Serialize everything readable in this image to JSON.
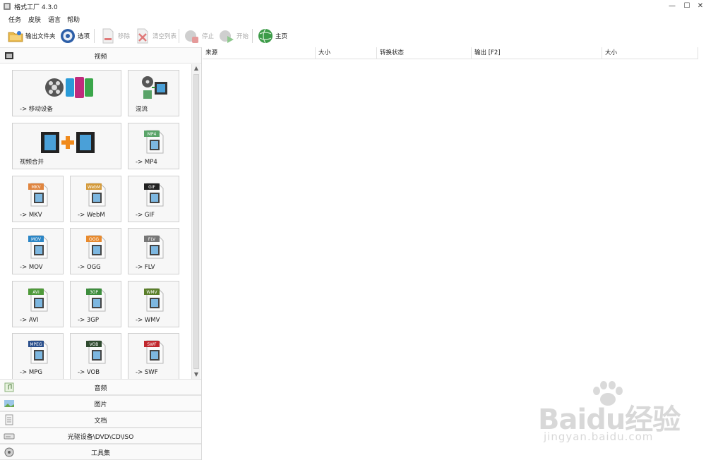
{
  "window": {
    "title": "格式工厂 4.3.0",
    "controls": [
      "—",
      "☐",
      "✕"
    ]
  },
  "menu": [
    "任务",
    "皮肤",
    "语言",
    "帮助"
  ],
  "toolbar": {
    "output_folder": "输出文件夹",
    "options": "选项",
    "remove": "移除",
    "clear_list": "清空列表",
    "stop": "停止",
    "start": "开始",
    "home": "主页"
  },
  "categories": {
    "video": "视频",
    "audio": "音频",
    "image": "图片",
    "document": "文档",
    "optical": "光驱设备\\DVD\\CD\\ISO",
    "tools": "工具集"
  },
  "tiles": [
    {
      "label": "-> 移动设备",
      "icon": "film-reel-phones-icon"
    },
    {
      "label": "混流",
      "icon": "mux-icon"
    },
    {
      "label": "视频合并",
      "icon": "video-join-icon"
    },
    {
      "label": "-> MP4",
      "icon": "mp4-file-icon",
      "badge": "MP4",
      "badge_color": "#5aa469"
    },
    {
      "label": "-> MKV",
      "icon": "mkv-file-icon",
      "badge": "MKV",
      "badge_color": "#e0853f"
    },
    {
      "label": "-> WebM",
      "icon": "webm-file-icon",
      "badge": "WebM",
      "badge_color": "#d49a3a"
    },
    {
      "label": "-> GIF",
      "icon": "gif-file-icon",
      "badge": "GIF",
      "badge_color": "#222222"
    },
    {
      "label": "-> MOV",
      "icon": "mov-file-icon",
      "badge": "MOV",
      "badge_color": "#2b86c6"
    },
    {
      "label": "-> OGG",
      "icon": "ogg-file-icon",
      "badge": "OGG",
      "badge_color": "#e88a2e"
    },
    {
      "label": "-> FLV",
      "icon": "flv-file-icon",
      "badge": "FLV",
      "badge_color": "#777777"
    },
    {
      "label": "-> AVI",
      "icon": "avi-file-icon",
      "badge": "AVI",
      "badge_color": "#4f9a3a"
    },
    {
      "label": "-> 3GP",
      "icon": "3gp-file-icon",
      "badge": "3GP",
      "badge_color": "#3d8d3d"
    },
    {
      "label": "-> WMV",
      "icon": "wmv-file-icon",
      "badge": "WMV",
      "badge_color": "#5b7f2a"
    },
    {
      "label": "-> MPG",
      "icon": "mpg-file-icon",
      "badge": "MPEG",
      "badge_color": "#2a4f8c"
    },
    {
      "label": "-> VOB",
      "icon": "vob-file-icon",
      "badge": "VOB",
      "badge_color": "#2f4a2f"
    },
    {
      "label": "-> SWF",
      "icon": "swf-file-icon",
      "badge": "SWF",
      "badge_color": "#c0272d"
    }
  ],
  "table_headers": [
    "来源",
    "大小",
    "转换状态",
    "输出 [F2]",
    "大小"
  ],
  "watermark": {
    "logo": "Baidu经验",
    "url": "jingyan.baidu.com"
  }
}
